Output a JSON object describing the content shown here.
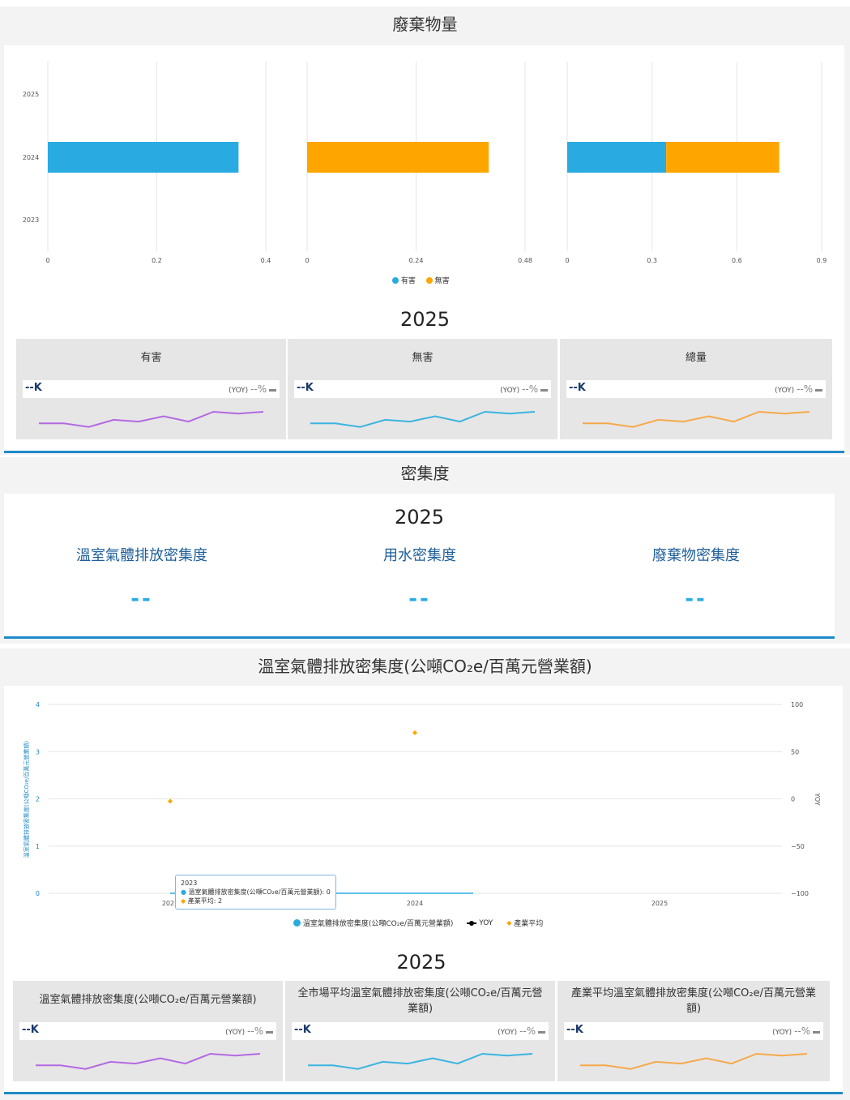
{
  "waste": {
    "title": "廢棄物量",
    "year_label": "2025",
    "legend": [
      "有害",
      "無害"
    ],
    "cards": [
      {
        "title": "有害",
        "value": "--K",
        "yoy_label": "(YOY)",
        "yoy_value": "--%",
        "spark_color": "#b36ae2"
      },
      {
        "title": "無害",
        "value": "--K",
        "yoy_label": "(YOY)",
        "yoy_value": "--%",
        "spark_color": "#3bb4e0"
      },
      {
        "title": "總量",
        "value": "--K",
        "yoy_label": "(YOY)",
        "yoy_value": "--%",
        "spark_color": "#f6a94b"
      }
    ]
  },
  "intensity": {
    "title": "密集度",
    "year_label": "2025",
    "items": [
      {
        "label": "溫室氣體排放密集度",
        "value": "--"
      },
      {
        "label": "用水密集度",
        "value": "--"
      },
      {
        "label": "廢棄物密集度",
        "value": "--"
      }
    ]
  },
  "ghg": {
    "title": "溫室氣體排放密集度(公噸CO₂e/百萬元營業額)",
    "y_axis_label": "溫室氣體排放密集度(公噸CO₂e/百萬元營業額)",
    "y2_axis_label": "YOY",
    "legend": [
      "溫室氣體排放密集度(公噸CO₂e/百萬元營業額)",
      "YOY",
      "產業平均"
    ],
    "tooltip": {
      "year": "2023",
      "line1": "溫室氣體排放密集度(公噸CO₂e/百萬元營業額): 0",
      "line2": "產業平均: 2"
    },
    "year_label": "2025",
    "cards": [
      {
        "title": "溫室氣體排放密集度(公噸CO₂e/百萬元營業額)",
        "value": "--K",
        "yoy_label": "(YOY)",
        "yoy_value": "--%",
        "spark_color": "#b36ae2"
      },
      {
        "title": "全市場平均溫室氣體排放密集度(公噸CO₂e/百萬元營業額)",
        "value": "--K",
        "yoy_label": "(YOY)",
        "yoy_value": "--%",
        "spark_color": "#3bb4e0"
      },
      {
        "title": "產業平均溫室氣體排放密集度(公噸CO₂e/百萬元營業額)",
        "value": "--K",
        "yoy_label": "(YOY)",
        "yoy_value": "--%",
        "spark_color": "#f6a94b"
      }
    ]
  },
  "colors": {
    "hazardous": "#29abe2",
    "non_hazardous": "#ffa500",
    "industry_avg": "#ffa500",
    "accent": "#1f8ac8"
  },
  "chart_data": [
    {
      "type": "bar",
      "orientation": "horizontal",
      "categories": [
        "2025",
        "2024",
        "2023"
      ],
      "panels": [
        {
          "series": [
            {
              "name": "有害",
              "values": [
                0,
                0.35,
                0
              ]
            }
          ],
          "xlim": [
            0,
            0.4
          ],
          "ticks": [
            "0",
            "0.2",
            "0.4"
          ]
        },
        {
          "series": [
            {
              "name": "無害",
              "values": [
                0,
                0.4,
                0
              ]
            }
          ],
          "xlim": [
            0,
            0.48
          ],
          "ticks": [
            "0",
            "0.24",
            "0.48"
          ]
        },
        {
          "stacked": true,
          "series": [
            {
              "name": "有害",
              "values": [
                0,
                0.35,
                0
              ]
            },
            {
              "name": "無害",
              "values": [
                0,
                0.4,
                0
              ]
            }
          ],
          "xlim": [
            0,
            0.9
          ],
          "ticks": [
            "0",
            "0.3",
            "0.6",
            "0.9"
          ]
        }
      ],
      "legend": [
        "有害",
        "無害"
      ],
      "legend_position": "bottom",
      "grid": true
    },
    {
      "type": "line",
      "categories": [
        "2023",
        "2024",
        "2025"
      ],
      "series": [
        {
          "name": "溫室氣體排放密集度(公噸CO₂e/百萬元營業額)",
          "values": [
            0,
            0,
            null
          ]
        },
        {
          "name": "YOY",
          "values": [
            null,
            null,
            null
          ]
        },
        {
          "name": "產業平均",
          "values": [
            1.95,
            3.4,
            null
          ]
        }
      ],
      "ylim": [
        0,
        4
      ],
      "yticks": [
        "0",
        "1",
        "2",
        "3",
        "4"
      ],
      "y2lim": [
        -100,
        100
      ],
      "y2ticks": [
        "100",
        "50",
        "0",
        "−50",
        "−100"
      ],
      "ylabel": "溫室氣體排放密集度(公噸CO₂e/百萬元營業額)",
      "y2label": "YOY",
      "legend_position": "bottom",
      "grid": true
    }
  ]
}
